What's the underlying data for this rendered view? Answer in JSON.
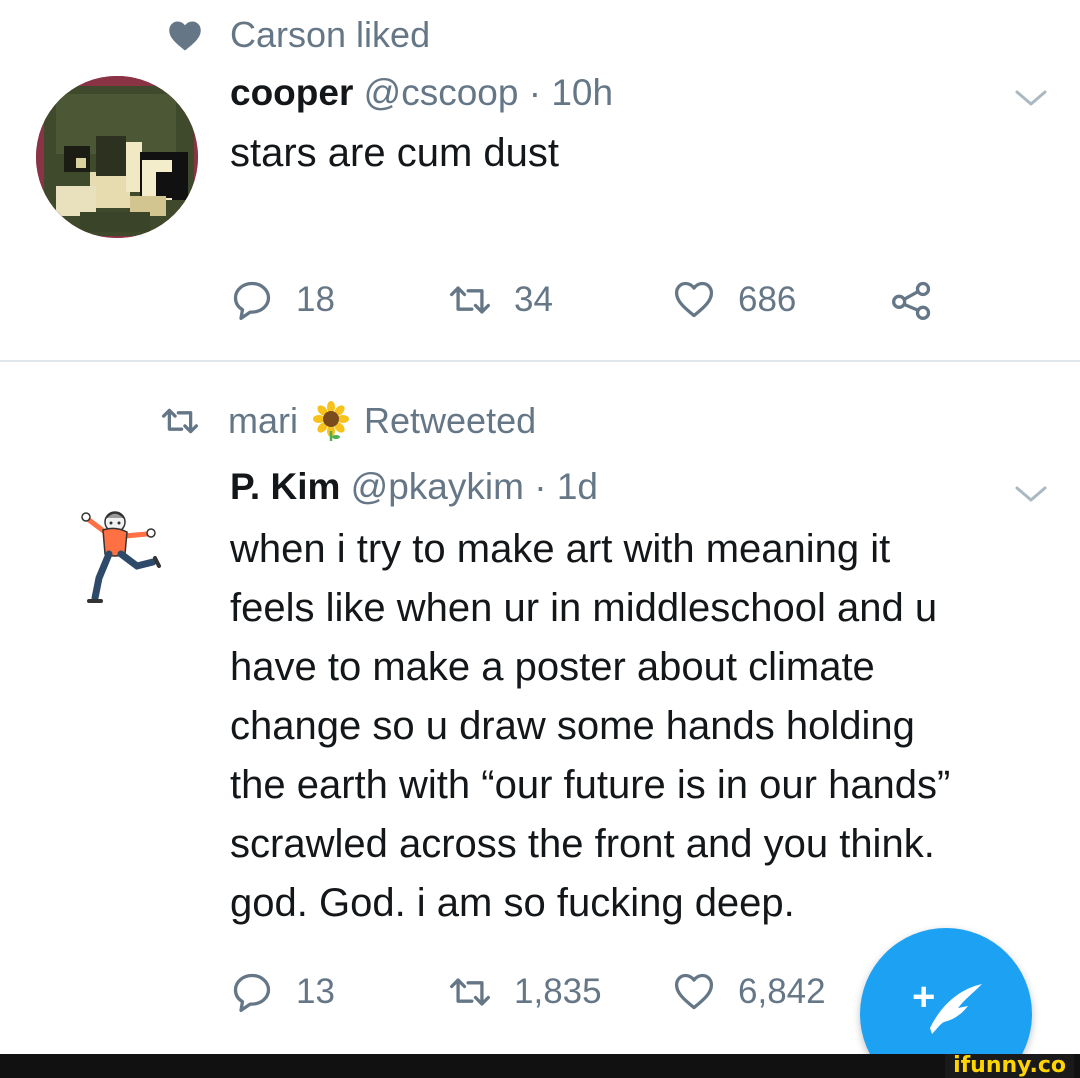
{
  "tweet1": {
    "context": {
      "icon": "heart-filled-icon",
      "text": "Carson liked"
    },
    "name": "cooper",
    "handle": "@cscoop",
    "separator": "·",
    "time": "10h",
    "text": "stars are cum dust",
    "actions": {
      "replies": "18",
      "retweets": "34",
      "likes": "686"
    }
  },
  "tweet2": {
    "context": {
      "icon": "retweet-icon",
      "user": "mari",
      "emoji": "sunflower-emoji",
      "suffix": "Retweeted"
    },
    "name": "P. Kim",
    "handle": "@pkaykim",
    "separator": "·",
    "time": "1d",
    "lines": [
      "when i try to make art with meaning it",
      "feels like when ur in middleschool and u",
      "have to make a poster about climate",
      "change so u draw some hands holding",
      "the earth with “our future is in our hands”",
      "scrawled across the front and you think.",
      "god. God. i am so fucking deep."
    ],
    "actions": {
      "replies": "13",
      "retweets": "1,835",
      "likes": "6,842"
    }
  },
  "fab": {
    "icon": "compose-tweet-icon",
    "plus": "+"
  },
  "watermark": "ifunny.co",
  "colors": {
    "accent": "#1da1f2",
    "muted": "#657786",
    "text": "#14171a",
    "divider": "#e1e8ed"
  }
}
